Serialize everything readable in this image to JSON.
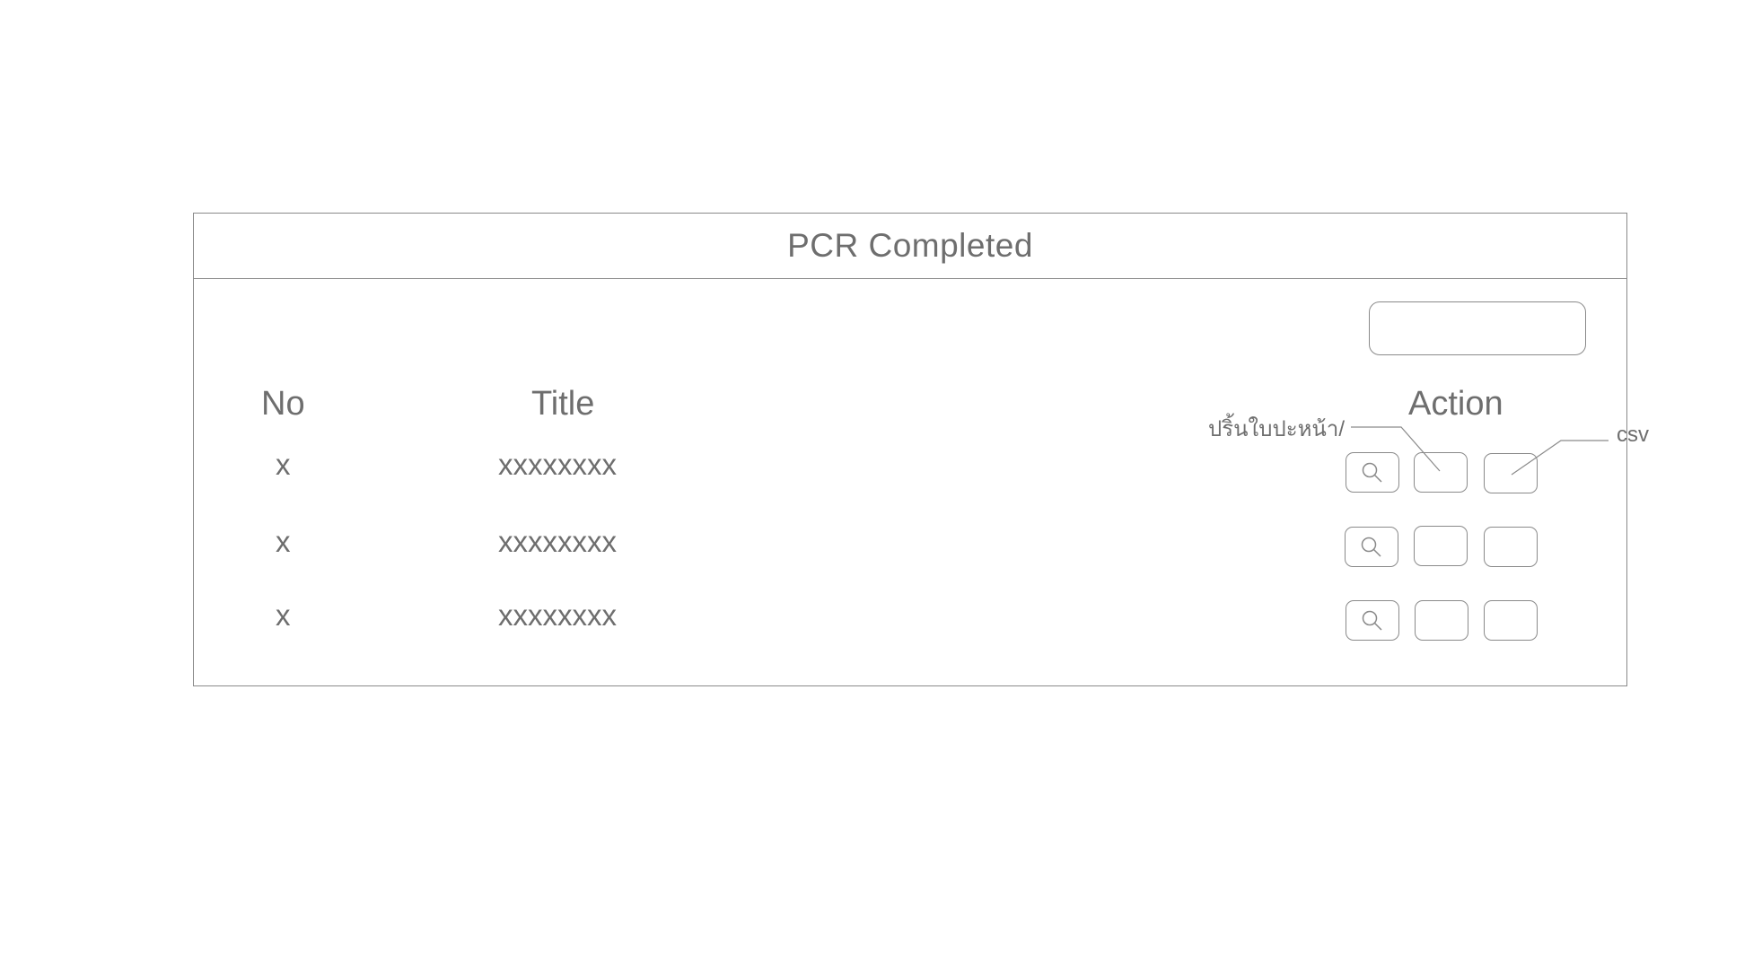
{
  "panel": {
    "title": "PCR Completed",
    "search": {
      "value": "",
      "placeholder": ""
    }
  },
  "table": {
    "columns": [
      "No",
      "Title",
      "Action"
    ],
    "rows": [
      {
        "no": "x",
        "title": "xxxxxxxx"
      },
      {
        "no": "x",
        "title": "xxxxxxxx"
      },
      {
        "no": "x",
        "title": "xxxxxxxx"
      }
    ],
    "actions": [
      {
        "icon": "search-icon",
        "label": ""
      },
      {
        "icon": "",
        "label": ""
      },
      {
        "icon": "",
        "label": ""
      }
    ]
  },
  "annotations": {
    "print_button_note": "ปริ้นใบปะหน้า/",
    "csv_button_note": "csv"
  },
  "colors": {
    "stroke": "#8a8a8a",
    "text": "#6e6e6e",
    "background": "#ffffff"
  }
}
